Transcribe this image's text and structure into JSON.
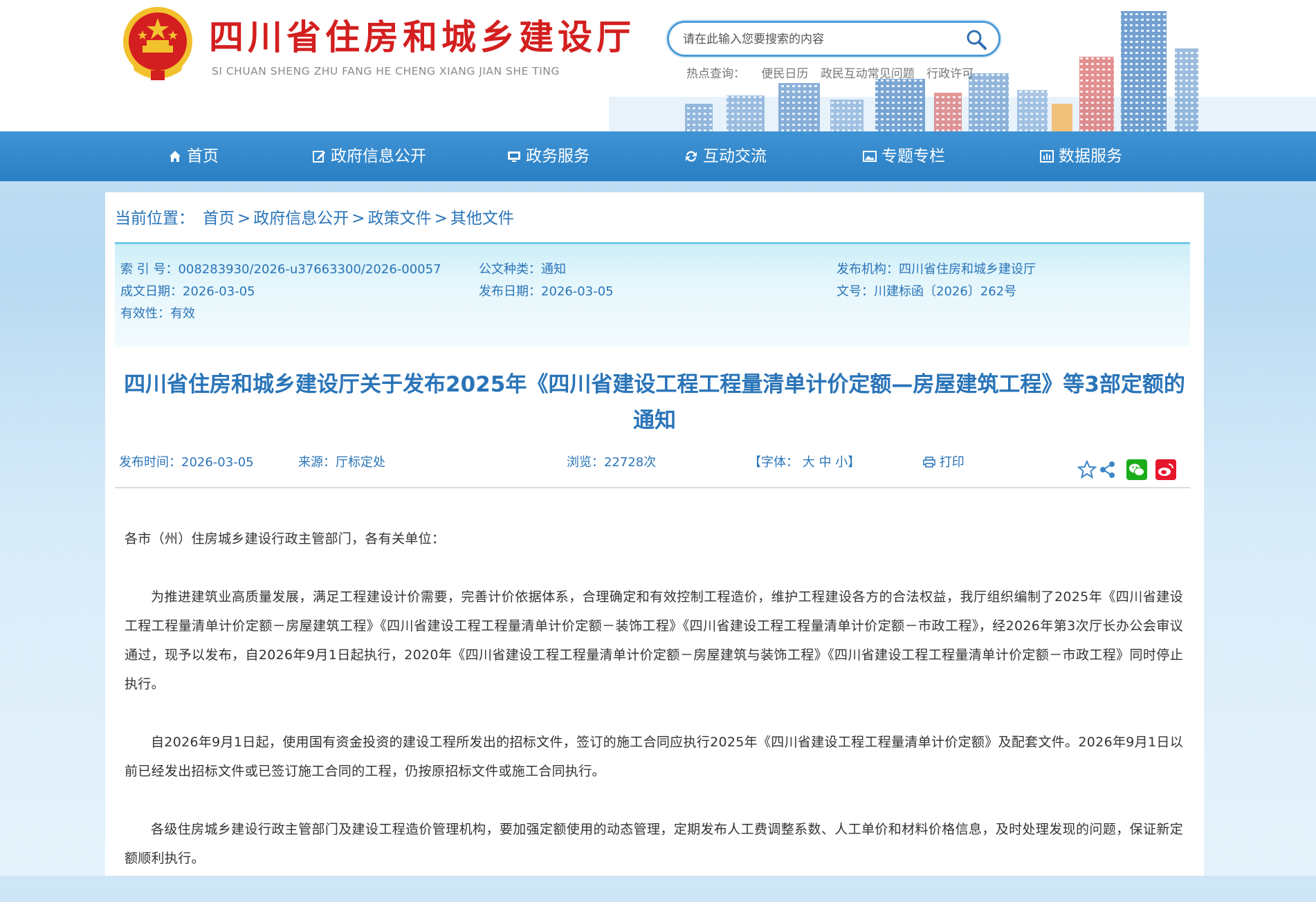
{
  "header": {
    "title": "四川省住房和城乡建设厅",
    "subtitle": "SI CHUAN SHENG ZHU FANG HE CHENG XIANG JIAN SHE TING",
    "search_placeholder": "请在此输入您要搜索的内容",
    "hot_label": "热点查询：",
    "hot_links": [
      "便民日历",
      "政民互动常见问题",
      "行政许可"
    ]
  },
  "nav": [
    {
      "label": "首页",
      "icon": "home-icon"
    },
    {
      "label": "政府信息公开",
      "icon": "edit-icon"
    },
    {
      "label": "政务服务",
      "icon": "monitor-icon"
    },
    {
      "label": "互动交流",
      "icon": "exchange-icon"
    },
    {
      "label": "专题专栏",
      "icon": "image-icon"
    },
    {
      "label": "数据服务",
      "icon": "chart-icon"
    }
  ],
  "breadcrumb": {
    "label": "当前位置：",
    "items": [
      "首页",
      "政府信息公开",
      "政策文件",
      "其他文件"
    ]
  },
  "meta": {
    "index_no": "索 引 号：008283930/2026-u37663300/2026-00057",
    "doc_type": "公文种类：通知",
    "publisher": "发布机构：四川省住房和城乡建设厅",
    "written_date": "成文日期：2026-03-05",
    "publish_date": "发布日期：2026-03-05",
    "doc_no": "文号：川建标函〔2026〕262号",
    "validity": "有效性：有效"
  },
  "article": {
    "title": "四川省住房和城乡建设厅关于发布2025年《四川省建设工程工程量清单计价定额—房屋建筑工程》等3部定额的通知",
    "publish_time": "发布时间：2026-03-05",
    "source": "来源：厅标定处",
    "views": "浏览：22728次",
    "font_label": "【字体：",
    "font_large": "大",
    "font_medium": "中",
    "font_small": "小",
    "font_end": "】",
    "print": "打印",
    "salutation": "各市（州）住房城乡建设行政主管部门，各有关单位：",
    "paragraphs": [
      "为推进建筑业高质量发展，满足工程建设计价需要，完善计价依据体系，合理确定和有效控制工程造价，维护工程建设各方的合法权益，我厅组织编制了2025年《四川省建设工程工程量清单计价定额－房屋建筑工程》《四川省建设工程工程量清单计价定额－装饰工程》《四川省建设工程工程量清单计价定额－市政工程》，经2026年第3次厅长办公会审议通过，现予以发布，自2026年9月1日起执行，2020年《四川省建设工程工程量清单计价定额－房屋建筑与装饰工程》《四川省建设工程工程量清单计价定额－市政工程》同时停止执行。",
      "自2026年9月1日起，使用国有资金投资的建设工程所发出的招标文件，签订的施工合同应执行2025年《四川省建设工程工程量清单计价定额》及配套文件。2026年9月1日以前已经发出招标文件或已签订施工合同的工程，仍按原招标文件或施工合同执行。",
      "各级住房城乡建设行政主管部门及建设工程造价管理机构，要加强定额使用的动态管理，定期发布人工费调整系数、人工单价和材料价格信息，及时处理发现的问题，保证新定额顺利执行。"
    ]
  },
  "colors": {
    "brand_red": "#d31f1f",
    "nav_blue": "#2a7fc4",
    "link_blue": "#2a74b8",
    "wechat_green": "#1aad19",
    "weibo_red": "#e6162d"
  }
}
